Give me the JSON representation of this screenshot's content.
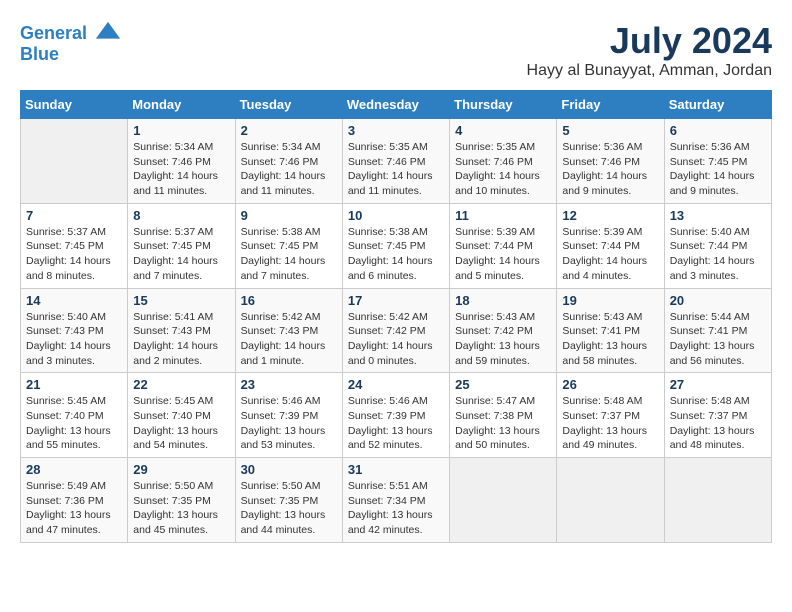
{
  "header": {
    "logo_line1": "General",
    "logo_line2": "Blue",
    "month_year": "July 2024",
    "location": "Hayy al Bunayyat, Amman, Jordan"
  },
  "days_of_week": [
    "Sunday",
    "Monday",
    "Tuesday",
    "Wednesday",
    "Thursday",
    "Friday",
    "Saturday"
  ],
  "weeks": [
    [
      {
        "day": "",
        "info": ""
      },
      {
        "day": "1",
        "info": "Sunrise: 5:34 AM\nSunset: 7:46 PM\nDaylight: 14 hours\nand 11 minutes."
      },
      {
        "day": "2",
        "info": "Sunrise: 5:34 AM\nSunset: 7:46 PM\nDaylight: 14 hours\nand 11 minutes."
      },
      {
        "day": "3",
        "info": "Sunrise: 5:35 AM\nSunset: 7:46 PM\nDaylight: 14 hours\nand 11 minutes."
      },
      {
        "day": "4",
        "info": "Sunrise: 5:35 AM\nSunset: 7:46 PM\nDaylight: 14 hours\nand 10 minutes."
      },
      {
        "day": "5",
        "info": "Sunrise: 5:36 AM\nSunset: 7:46 PM\nDaylight: 14 hours\nand 9 minutes."
      },
      {
        "day": "6",
        "info": "Sunrise: 5:36 AM\nSunset: 7:45 PM\nDaylight: 14 hours\nand 9 minutes."
      }
    ],
    [
      {
        "day": "7",
        "info": "Sunrise: 5:37 AM\nSunset: 7:45 PM\nDaylight: 14 hours\nand 8 minutes."
      },
      {
        "day": "8",
        "info": "Sunrise: 5:37 AM\nSunset: 7:45 PM\nDaylight: 14 hours\nand 7 minutes."
      },
      {
        "day": "9",
        "info": "Sunrise: 5:38 AM\nSunset: 7:45 PM\nDaylight: 14 hours\nand 7 minutes."
      },
      {
        "day": "10",
        "info": "Sunrise: 5:38 AM\nSunset: 7:45 PM\nDaylight: 14 hours\nand 6 minutes."
      },
      {
        "day": "11",
        "info": "Sunrise: 5:39 AM\nSunset: 7:44 PM\nDaylight: 14 hours\nand 5 minutes."
      },
      {
        "day": "12",
        "info": "Sunrise: 5:39 AM\nSunset: 7:44 PM\nDaylight: 14 hours\nand 4 minutes."
      },
      {
        "day": "13",
        "info": "Sunrise: 5:40 AM\nSunset: 7:44 PM\nDaylight: 14 hours\nand 3 minutes."
      }
    ],
    [
      {
        "day": "14",
        "info": "Sunrise: 5:40 AM\nSunset: 7:43 PM\nDaylight: 14 hours\nand 3 minutes."
      },
      {
        "day": "15",
        "info": "Sunrise: 5:41 AM\nSunset: 7:43 PM\nDaylight: 14 hours\nand 2 minutes."
      },
      {
        "day": "16",
        "info": "Sunrise: 5:42 AM\nSunset: 7:43 PM\nDaylight: 14 hours\nand 1 minute."
      },
      {
        "day": "17",
        "info": "Sunrise: 5:42 AM\nSunset: 7:42 PM\nDaylight: 14 hours\nand 0 minutes."
      },
      {
        "day": "18",
        "info": "Sunrise: 5:43 AM\nSunset: 7:42 PM\nDaylight: 13 hours\nand 59 minutes."
      },
      {
        "day": "19",
        "info": "Sunrise: 5:43 AM\nSunset: 7:41 PM\nDaylight: 13 hours\nand 58 minutes."
      },
      {
        "day": "20",
        "info": "Sunrise: 5:44 AM\nSunset: 7:41 PM\nDaylight: 13 hours\nand 56 minutes."
      }
    ],
    [
      {
        "day": "21",
        "info": "Sunrise: 5:45 AM\nSunset: 7:40 PM\nDaylight: 13 hours\nand 55 minutes."
      },
      {
        "day": "22",
        "info": "Sunrise: 5:45 AM\nSunset: 7:40 PM\nDaylight: 13 hours\nand 54 minutes."
      },
      {
        "day": "23",
        "info": "Sunrise: 5:46 AM\nSunset: 7:39 PM\nDaylight: 13 hours\nand 53 minutes."
      },
      {
        "day": "24",
        "info": "Sunrise: 5:46 AM\nSunset: 7:39 PM\nDaylight: 13 hours\nand 52 minutes."
      },
      {
        "day": "25",
        "info": "Sunrise: 5:47 AM\nSunset: 7:38 PM\nDaylight: 13 hours\nand 50 minutes."
      },
      {
        "day": "26",
        "info": "Sunrise: 5:48 AM\nSunset: 7:37 PM\nDaylight: 13 hours\nand 49 minutes."
      },
      {
        "day": "27",
        "info": "Sunrise: 5:48 AM\nSunset: 7:37 PM\nDaylight: 13 hours\nand 48 minutes."
      }
    ],
    [
      {
        "day": "28",
        "info": "Sunrise: 5:49 AM\nSunset: 7:36 PM\nDaylight: 13 hours\nand 47 minutes."
      },
      {
        "day": "29",
        "info": "Sunrise: 5:50 AM\nSunset: 7:35 PM\nDaylight: 13 hours\nand 45 minutes."
      },
      {
        "day": "30",
        "info": "Sunrise: 5:50 AM\nSunset: 7:35 PM\nDaylight: 13 hours\nand 44 minutes."
      },
      {
        "day": "31",
        "info": "Sunrise: 5:51 AM\nSunset: 7:34 PM\nDaylight: 13 hours\nand 42 minutes."
      },
      {
        "day": "",
        "info": ""
      },
      {
        "day": "",
        "info": ""
      },
      {
        "day": "",
        "info": ""
      }
    ]
  ]
}
